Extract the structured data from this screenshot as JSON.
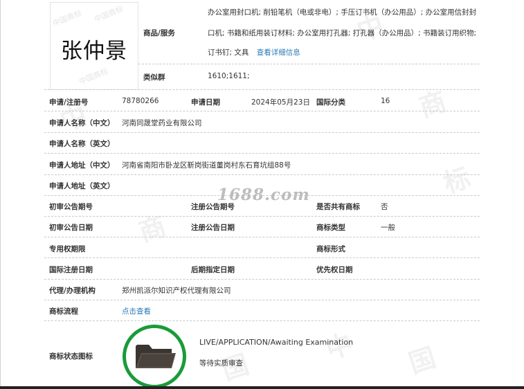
{
  "logo": {
    "text": "张仲景",
    "watermark": "中国商标"
  },
  "goods_services": {
    "label": "商品/服务",
    "lines": [
      "办公室用封口机; 削铅笔机（电或非电）; 手压订书机（办公用品）; 办公室用信封封",
      "口机; 书籍和纸用装订材料; 办公室用打孔器; 打孔器（办公用品）; 书籍装订用织物;",
      "订书钉; 文具"
    ],
    "details_link": "查看详细信息"
  },
  "similar_groups": {
    "label": "类似群",
    "value": "1610;1611;"
  },
  "fields": {
    "reg_no_label": "申请/注册号",
    "reg_no": "78780266",
    "app_date_label": "申请日期",
    "app_date": "2024年05月23日",
    "intl_class_label": "国际分类",
    "intl_class": "16",
    "applicant_cn_label": "申请人名称（中文）",
    "applicant_cn": "河南同晟堂药业有限公司",
    "applicant_en_label": "申请人名称（英文）",
    "applicant_en": "",
    "address_cn_label": "申请人地址（中文）",
    "address_cn": "河南省南阳市卧龙区靳岗街道董岗村东石育坑组88号",
    "address_en_label": "申请人地址（英文）",
    "address_en": "",
    "prelim_issue_label": "初审公告期号",
    "prelim_issue": "",
    "reg_issue_label": "注册公告期号",
    "reg_issue": "",
    "shared_label": "是否共有商标",
    "shared": "否",
    "prelim_date_label": "初审公告日期",
    "prelim_date": "",
    "reg_date_label": "注册公告日期",
    "reg_date": "",
    "tm_type_label": "商标类型",
    "tm_type": "一般",
    "exclusive_label": "专用权期限",
    "exclusive": "",
    "tm_form_label": "商标形式",
    "tm_form": "",
    "intl_reg_label": "国际注册日期",
    "intl_reg": "",
    "later_desig_label": "后期指定日期",
    "later_desig": "",
    "priority_label": "优先权日期",
    "priority": "",
    "agent_label": "代理/办理机构",
    "agent": "郑州凯派尔知识产权代理有限公司",
    "process_label": "商标流程",
    "process_link": "点击查看",
    "status_icon_label": "商标状态图标"
  },
  "status": {
    "en": "LIVE/APPLICATION/Awaiting Examination",
    "cn": "等待实质审查",
    "icon": "folder-icon",
    "ring_color": "#1a9b3a"
  },
  "watermark_site": "1688.com",
  "colors": {
    "link": "#2a7bb5",
    "text": "#333333"
  }
}
